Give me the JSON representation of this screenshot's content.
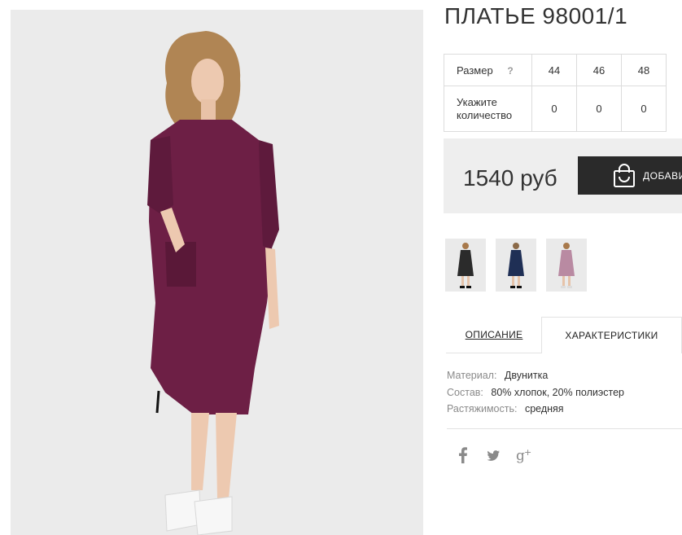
{
  "product": {
    "title": "ПЛАТЬЕ 98001/1",
    "dress_color": "#6d1f45"
  },
  "sizes": {
    "size_label": "Размер",
    "help": "?",
    "qty_label_line1": "Укажите",
    "qty_label_line2": "количество",
    "items": [
      {
        "size": "44",
        "qty": "0"
      },
      {
        "size": "46",
        "qty": "0"
      },
      {
        "size": "48",
        "qty": "0"
      }
    ]
  },
  "price": {
    "value": "1540 руб",
    "add_button_label": "ДОБАВИТЬ"
  },
  "thumbnails": [
    {
      "name": "thumb-black",
      "color": "#2b2b2b"
    },
    {
      "name": "thumb-navy",
      "color": "#1f2f55"
    },
    {
      "name": "thumb-mauve",
      "color": "#b98aa2"
    }
  ],
  "tabs": {
    "description": "ОПИСАНИЕ",
    "characteristics": "ХАРАКТЕРИСТИКИ"
  },
  "specs": [
    {
      "label": "Материал:",
      "value": "Двунитка"
    },
    {
      "label": "Состав:",
      "value": "80% хлопок, 20% полиэстер"
    },
    {
      "label": "Растяжимость:",
      "value": "средняя"
    }
  ],
  "social": [
    "facebook-icon",
    "twitter-icon",
    "google-plus-icon"
  ]
}
